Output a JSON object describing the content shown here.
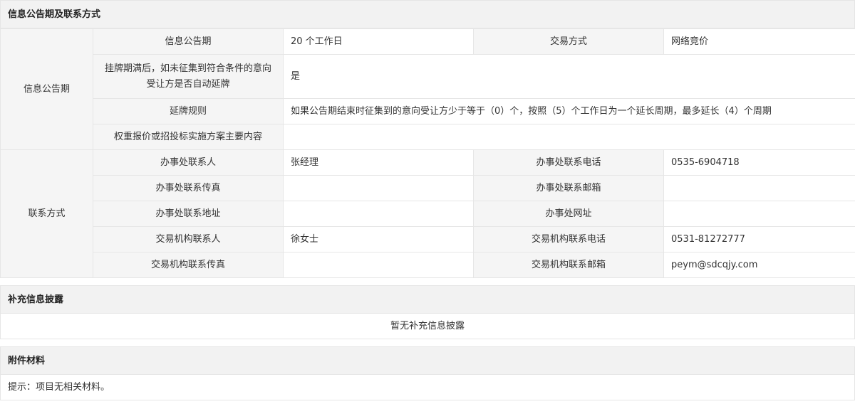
{
  "section1": {
    "title": "信息公告期及联系方式",
    "group1_label": "信息公告期",
    "group2_label": "联系方式",
    "rows": {
      "announce_period_label": "信息公告期",
      "announce_period_value": "20 个工作日",
      "trade_method_label": "交易方式",
      "trade_method_value": "网络竞价",
      "auto_extend_label": "挂牌期满后，如未征集到符合条件的意向受让方是否自动延牌",
      "auto_extend_value": "是",
      "extend_rule_label": "延牌规则",
      "extend_rule_value": "如果公告期结束时征集到的意向受让方少于等于（0）个，按照（5）个工作日为一个延长周期，最多延长（4）个周期",
      "weighting_label": "权重报价或招投标实施方案主要内容",
      "weighting_value": "",
      "office_contact_label": "办事处联系人",
      "office_contact_value": "张经理",
      "office_phone_label": "办事处联系电话",
      "office_phone_value": "0535-6904718",
      "office_fax_label": "办事处联系传真",
      "office_fax_value": "",
      "office_email_label": "办事处联系邮箱",
      "office_email_value": "",
      "office_address_label": "办事处联系地址",
      "office_address_value": "",
      "office_website_label": "办事处网址",
      "office_website_value": "",
      "agency_contact_label": "交易机构联系人",
      "agency_contact_value": "徐女士",
      "agency_phone_label": "交易机构联系电话",
      "agency_phone_value": "0531-81272777",
      "agency_fax_label": "交易机构联系传真",
      "agency_fax_value": "",
      "agency_email_label": "交易机构联系邮箱",
      "agency_email_value": "peym@sdcqjy.com"
    }
  },
  "section2": {
    "title": "补充信息披露",
    "empty_text": "暂无补充信息披露"
  },
  "section3": {
    "title": "附件材料",
    "hint_text": "提示：项目无相关材料。"
  }
}
